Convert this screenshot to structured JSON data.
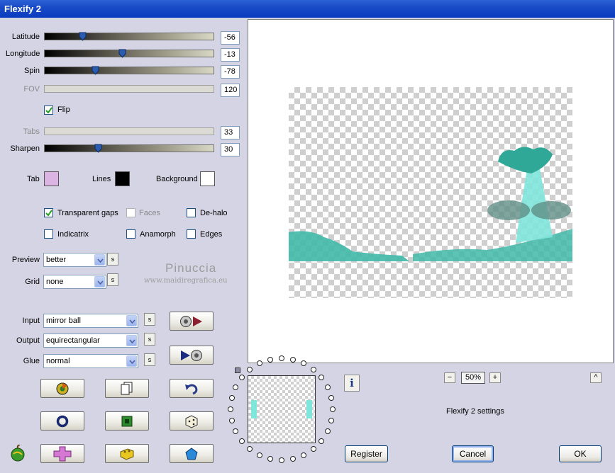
{
  "window": {
    "title": "Flexify 2"
  },
  "sliders": {
    "latitude": {
      "label": "Latitude",
      "value": "-56",
      "fraction": 0.21
    },
    "longitude": {
      "label": "Longitude",
      "value": "-13",
      "fraction": 0.46
    },
    "spin": {
      "label": "Spin",
      "value": "-78",
      "fraction": 0.29
    },
    "fov": {
      "label": "FOV",
      "value": "120"
    },
    "tabs": {
      "label": "Tabs",
      "value": "33"
    },
    "sharpen": {
      "label": "Sharpen",
      "value": "30",
      "fraction": 0.31
    }
  },
  "flip": {
    "label": "Flip",
    "checked": true
  },
  "colors": {
    "tab": {
      "label": "Tab",
      "color": "#dcb4e4"
    },
    "lines": {
      "label": "Lines",
      "color": "#000000"
    },
    "background": {
      "label": "Background",
      "color": "#ffffff"
    }
  },
  "options": {
    "transparent_gaps": {
      "label": "Transparent gaps",
      "checked": true
    },
    "faces": {
      "label": "Faces",
      "checked": false
    },
    "de_halo": {
      "label": "De-halo",
      "checked": false
    },
    "indicatrix": {
      "label": "Indicatrix",
      "checked": false
    },
    "anamorph": {
      "label": "Anamorph",
      "checked": false
    },
    "edges": {
      "label": "Edges",
      "checked": false
    }
  },
  "preview_select": {
    "label": "Preview",
    "value": "better"
  },
  "grid_select": {
    "label": "Grid",
    "value": "none"
  },
  "input_select": {
    "label": "Input",
    "value": "mirror ball"
  },
  "output_select": {
    "label": "Output",
    "value": "equirectangular"
  },
  "glue_select": {
    "label": "Glue",
    "value": "normal"
  },
  "small_s": "s",
  "watermark": {
    "line1": "Pinuccia",
    "line2": "www.maidiregrafica.eu"
  },
  "zoom": {
    "minus": "−",
    "value": "50%",
    "plus": "+"
  },
  "collapse_label": "^",
  "info_label": "i",
  "settings_label": "Flexify 2 settings",
  "buttons": {
    "register": "Register",
    "cancel": "Cancel",
    "ok": "OK"
  },
  "icons": {
    "convert_forward": "sphere-to-play-icon",
    "convert_back": "play-to-sphere-icon",
    "randomize_colors": "color-wheel-icon",
    "copy": "copy-icon",
    "undo": "undo-icon",
    "circle": "ring-icon",
    "square": "square-icon",
    "dice": "dice-icon",
    "cross": "cross-icon",
    "box": "box-icon",
    "pentagon": "pentagon-icon",
    "logo": "apple-logo-icon"
  },
  "accent_colors": {
    "teal": "#3fb8a8",
    "titlebar": "#0a3bbf"
  }
}
